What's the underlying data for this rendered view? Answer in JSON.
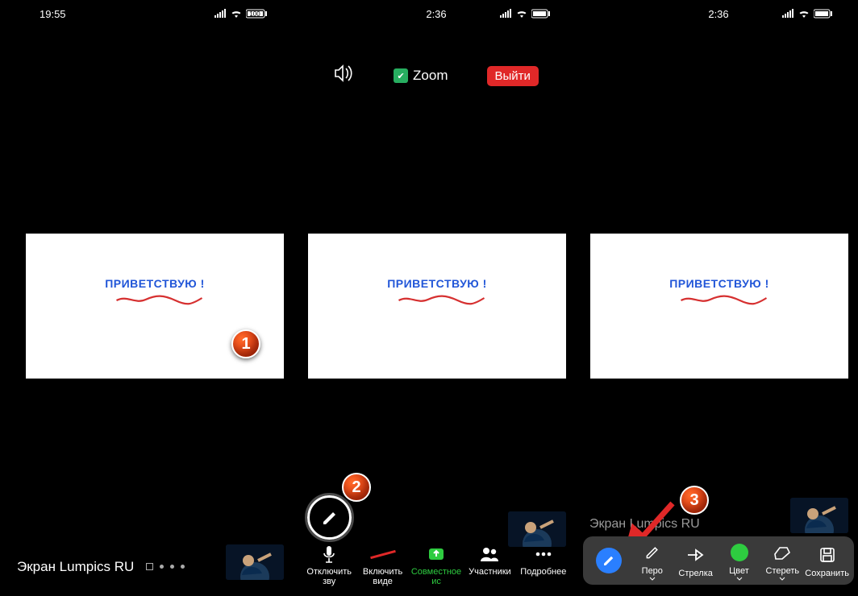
{
  "pane1": {
    "status_time": "19:55",
    "battery_text": "100",
    "board_text": "ПРИВЕТСТВУЮ !",
    "bottom_label": "Экран Lumpics RU",
    "marker": "1"
  },
  "pane2": {
    "status_time": "2:36",
    "topbar": {
      "app_label": "Zoom",
      "exit_label": "Выйти"
    },
    "board_text": "ПРИВЕТСТВУЮ !",
    "marker": "2",
    "toolbar": {
      "mute": "Отключить зву",
      "video": "Включить виде",
      "share": "Совместное ис",
      "participants": "Участники",
      "more": "Подробнее"
    }
  },
  "pane3": {
    "status_time": "2:36",
    "board_text": "ПРИВЕТСТВУЮ !",
    "bottom_label": "Экран Lumpics RU",
    "marker": "3",
    "anntoolbar": {
      "pen": "Перо",
      "arrow": "Стрелка",
      "color": "Цвет",
      "erase": "Стереть",
      "save": "Сохранить"
    }
  }
}
